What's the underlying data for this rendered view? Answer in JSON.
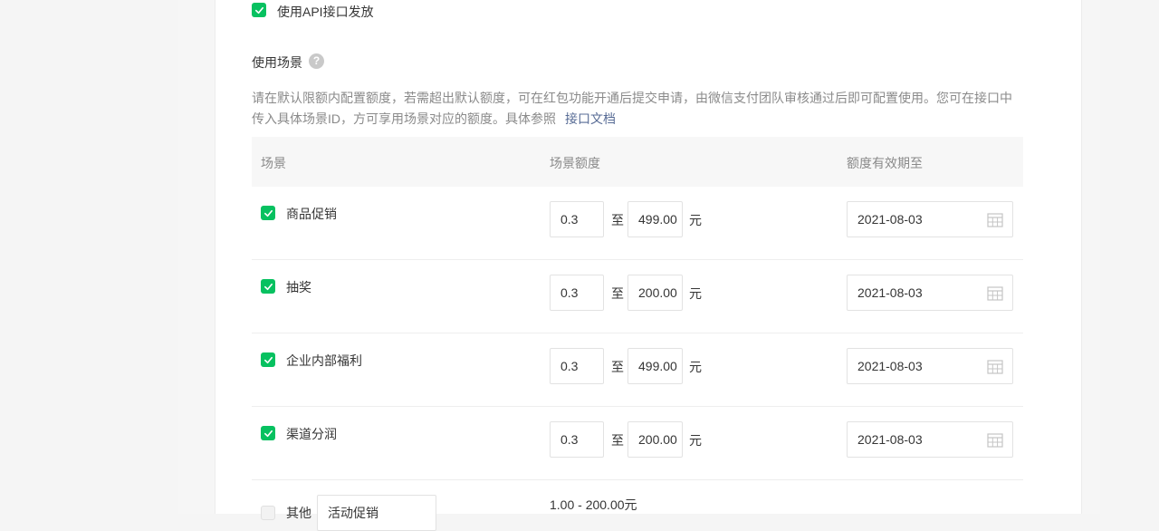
{
  "api_option": {
    "label": "使用API接口发放",
    "checked": true
  },
  "scene_section": {
    "title": "使用场景",
    "help_icon": "question-icon",
    "description": "请在默认限额内配置额度，若需超出默认额度，可在红包功能开通后提交申请，由微信支付团队审核通过后即可配置使用。您可在接口中传入具体场景ID，方可享用场景对应的额度。具体参照",
    "doc_link": "接口文档"
  },
  "table": {
    "headers": {
      "scene": "场景",
      "amount": "场景额度",
      "expiry": "额度有效期至"
    },
    "to_label": "至",
    "unit_label": "元",
    "rows": [
      {
        "label": "商品促销",
        "checked": true,
        "min": "0.3",
        "max": "499.00",
        "date": "2021-08-03"
      },
      {
        "label": "抽奖",
        "checked": true,
        "min": "0.3",
        "max": "200.00",
        "date": "2021-08-03"
      },
      {
        "label": "企业内部福利",
        "checked": true,
        "min": "0.3",
        "max": "499.00",
        "date": "2021-08-03"
      },
      {
        "label": "渠道分润",
        "checked": true,
        "min": "0.3",
        "max": "200.00",
        "date": "2021-08-03"
      }
    ],
    "other_row": {
      "label": "其他",
      "checked": false,
      "input_value": "活动促销",
      "range_text": "1.00 - 200.00元"
    }
  },
  "colors": {
    "accent_green": "#07c160",
    "link_blue": "#576b95",
    "muted_text": "#8a8a8a"
  }
}
